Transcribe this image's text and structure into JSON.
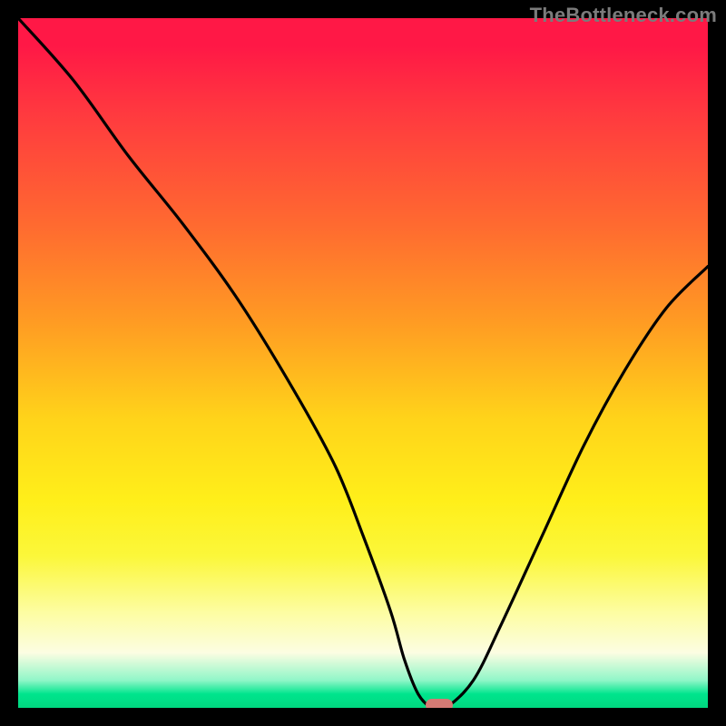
{
  "watermark": {
    "text": "TheBottleneck.com"
  },
  "chart_data": {
    "type": "line",
    "title": "",
    "xlabel": "",
    "ylabel": "",
    "xlim": [
      0,
      100
    ],
    "ylim": [
      0,
      100
    ],
    "grid": false,
    "legend": false,
    "series": [
      {
        "name": "curve",
        "x": [
          0,
          8,
          16,
          24,
          32,
          40,
          46,
          50,
          54,
          56,
          58,
          60,
          62,
          66,
          70,
          76,
          82,
          88,
          94,
          100
        ],
        "y": [
          100,
          91,
          80,
          70,
          59,
          46,
          35,
          25,
          14,
          7,
          2,
          0,
          0,
          4,
          12,
          25,
          38,
          49,
          58,
          64
        ]
      }
    ],
    "marker": {
      "x": 61,
      "y": 0,
      "color": "#d47a74"
    },
    "background_gradient": {
      "stops": [
        {
          "pos": 0.0,
          "color": "#ff1846"
        },
        {
          "pos": 0.3,
          "color": "#ff6a30"
        },
        {
          "pos": 0.58,
          "color": "#ffd31a"
        },
        {
          "pos": 0.86,
          "color": "#fdfda0"
        },
        {
          "pos": 0.98,
          "color": "#00e58d"
        }
      ]
    }
  }
}
